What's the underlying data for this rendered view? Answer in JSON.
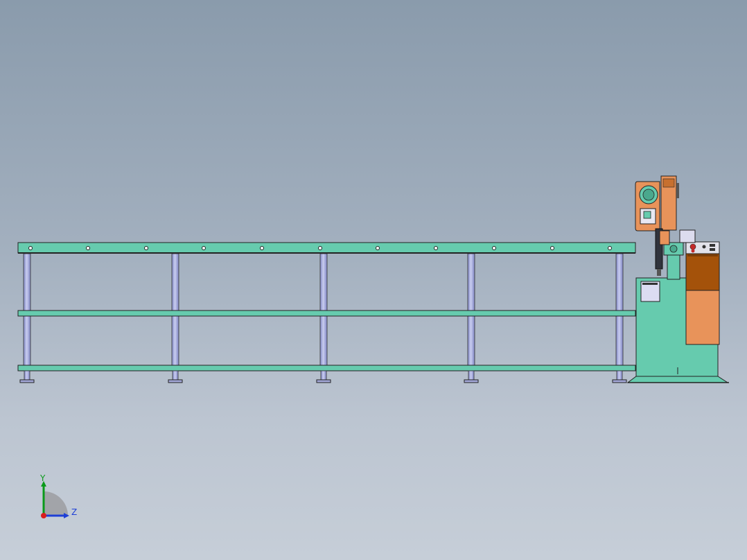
{
  "triad": {
    "y_label": "Y",
    "z_label": "Z",
    "y_color": "#0a9a1a",
    "z_color": "#1e3fd6",
    "x_color": "#d81e1e"
  },
  "nameplate_text": "",
  "colors": {
    "frame": "#66cbae",
    "post": "#a3a8d8",
    "drive_orange": "#e8935a",
    "drive_brown": "#a4520a",
    "outline": "#222222"
  }
}
